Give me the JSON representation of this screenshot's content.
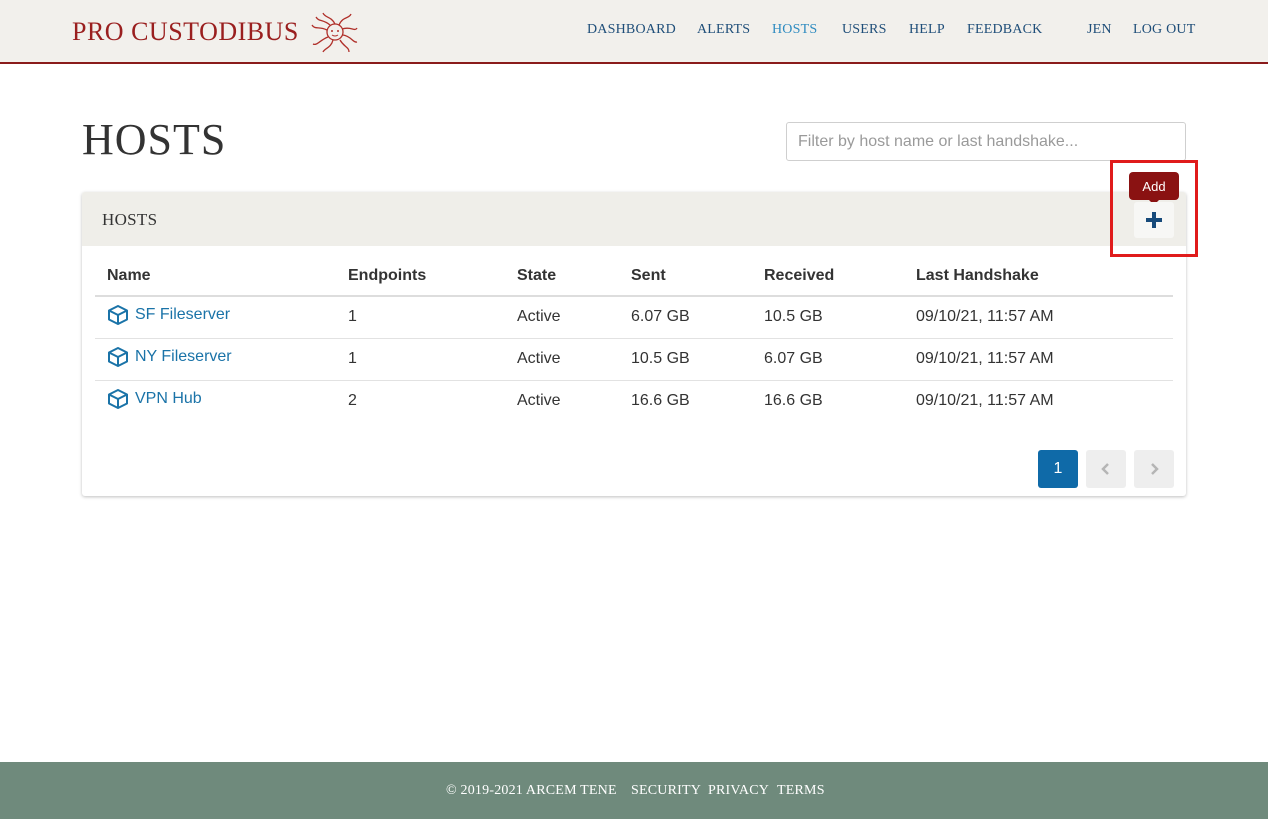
{
  "header": {
    "brand": "PRO CUSTODIBUS",
    "nav": {
      "dashboard": "DASHBOARD",
      "alerts": "ALERTS",
      "hosts": "HOSTS",
      "users": "USERS",
      "help": "HELP",
      "feedback": "FEEDBACK",
      "user": "JEN",
      "logout": "LOG OUT"
    },
    "colors": {
      "brand": "#9a1f1f",
      "nav": "#1f4e79",
      "nav_active": "#2e8bc0",
      "border": "#8a1b1b"
    }
  },
  "main": {
    "title": "HOSTS",
    "filter_placeholder": "Filter by host name or last handshake...",
    "card_title": "HOSTS",
    "add_tooltip": "Add",
    "add_icon": "plus-icon",
    "columns": [
      "Name",
      "Endpoints",
      "State",
      "Sent",
      "Received",
      "Last Handshake"
    ],
    "rows": [
      {
        "name": "SF Fileserver",
        "endpoints": "1",
        "state": "Active",
        "sent": "6.07 GB",
        "received": "10.5 GB",
        "last_handshake": "09/10/21, 11:57 AM"
      },
      {
        "name": "NY Fileserver",
        "endpoints": "1",
        "state": "Active",
        "sent": "10.5 GB",
        "received": "6.07 GB",
        "last_handshake": "09/10/21, 11:57 AM"
      },
      {
        "name": "VPN Hub",
        "endpoints": "2",
        "state": "Active",
        "sent": "16.6 GB",
        "received": "16.6 GB",
        "last_handshake": "09/10/21, 11:57 AM"
      }
    ],
    "row_icon": "cube-icon",
    "pagination": {
      "current_page": "1"
    }
  },
  "footer": {
    "copyright": "© 2019-2021 ARCEM TENE",
    "security": "SECURITY",
    "privacy": "PRIVACY",
    "terms": "TERMS",
    "color": "#6f8a7c"
  }
}
